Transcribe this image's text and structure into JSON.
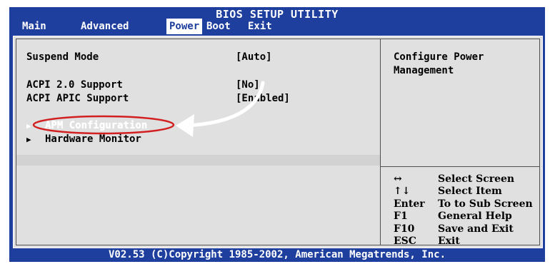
{
  "window": {
    "title": "BIOS SETUP UTILITY"
  },
  "menu": [
    {
      "label": "Main"
    },
    {
      "label": "Advanced"
    },
    {
      "label": "Power",
      "active": true
    },
    {
      "label": "Boot"
    },
    {
      "label": "Exit"
    }
  ],
  "settings": [
    {
      "label": "Suspend Mode",
      "value": "[Auto]"
    },
    {
      "label": "ACPI 2.0 Support",
      "value": "[No]"
    },
    {
      "label": "ACPI APIC Support",
      "value": "[Enabled]"
    }
  ],
  "submenus": [
    {
      "label": "APM Configuration",
      "highlighted": true,
      "arrow_icon": "triangle-right-icon"
    },
    {
      "label": "Hardware Monitor",
      "highlighted": false,
      "arrow_icon": "triangle-right-icon"
    }
  ],
  "help": {
    "text_line1": "Configure Power",
    "text_line2": "Management"
  },
  "keys": [
    {
      "key": "↔",
      "desc": "Select Screen"
    },
    {
      "key": "↑↓",
      "desc": "Select Item"
    },
    {
      "key": "Enter",
      "desc": "To to Sub Screen"
    },
    {
      "key": "F1",
      "desc": "General Help"
    },
    {
      "key": "F10",
      "desc": "Save and Exit"
    },
    {
      "key": "ESC",
      "desc": "Exit"
    }
  ],
  "footer": {
    "text": "V02.53 (C)Copyright 1985-2002, American Megatrends, Inc."
  },
  "colors": {
    "bios_blue": "#1f3f9f",
    "panel_gray": "#e0e0e0",
    "annotation_red": "#d22020"
  }
}
